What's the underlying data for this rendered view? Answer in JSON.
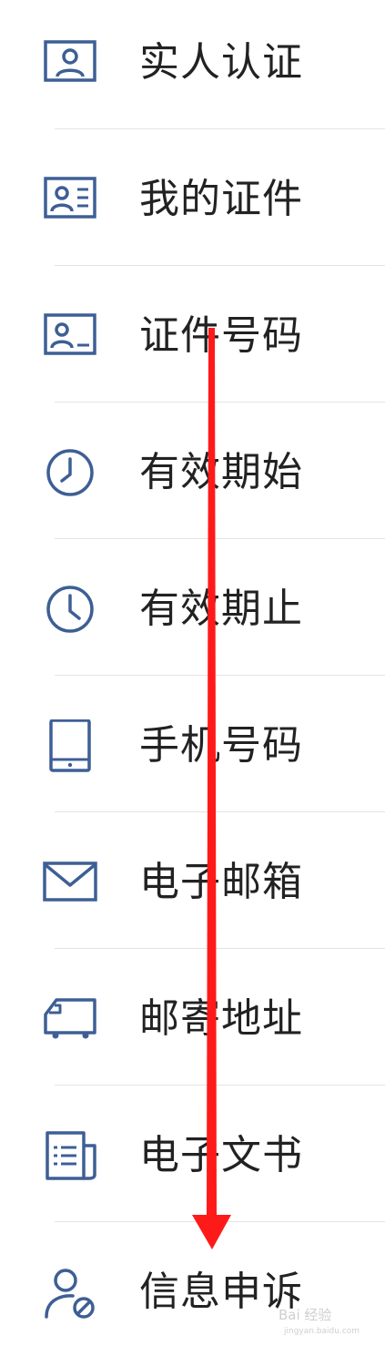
{
  "accent_color": "#3d5f95",
  "arrow_color": "#ff1a1a",
  "menu": {
    "items": [
      {
        "label": "实人认证",
        "icon": "user-id-card-icon"
      },
      {
        "label": "我的证件",
        "icon": "id-card-icon"
      },
      {
        "label": "证件号码",
        "icon": "id-number-card-icon"
      },
      {
        "label": "有效期始",
        "icon": "clock-start-icon"
      },
      {
        "label": "有效期止",
        "icon": "clock-end-icon"
      },
      {
        "label": "手机号码",
        "icon": "tablet-phone-icon"
      },
      {
        "label": "电子邮箱",
        "icon": "envelope-icon"
      },
      {
        "label": "邮寄地址",
        "icon": "delivery-truck-icon"
      },
      {
        "label": "电子文书",
        "icon": "document-icon"
      },
      {
        "label": "信息申诉",
        "icon": "user-blocked-icon"
      }
    ]
  },
  "watermark": {
    "text": "Bai 经验",
    "url_text": "jingyan.baidu.com"
  }
}
